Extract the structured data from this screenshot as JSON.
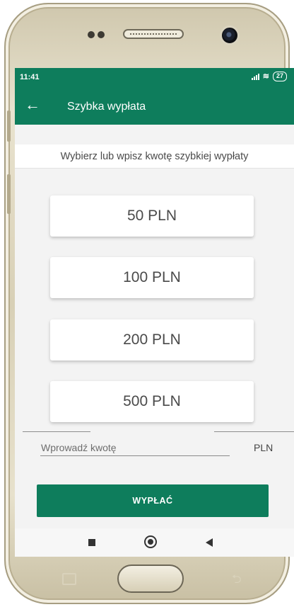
{
  "status_bar": {
    "time": "11:41",
    "battery": "27"
  },
  "app_bar": {
    "back_icon": "arrow-left-icon",
    "title": "Szybka wypłata"
  },
  "subtitle": "Wybierz lub wpisz kwotę szybkiej wypłaty",
  "amounts": [
    {
      "label": "50 PLN"
    },
    {
      "label": "100 PLN"
    },
    {
      "label": "200 PLN"
    },
    {
      "label": "500 PLN"
    }
  ],
  "amount_input": {
    "placeholder": "Wprowadź kwotę",
    "value": "",
    "currency": "PLN"
  },
  "submit_label": "WYPŁAĆ",
  "nav_bar": {
    "icons": [
      "recent-apps-icon",
      "home-icon",
      "back-triangle-icon"
    ]
  },
  "colors": {
    "primary": "#0e7d5c",
    "background": "#f3f3f3",
    "text": "#4a4a4a"
  }
}
